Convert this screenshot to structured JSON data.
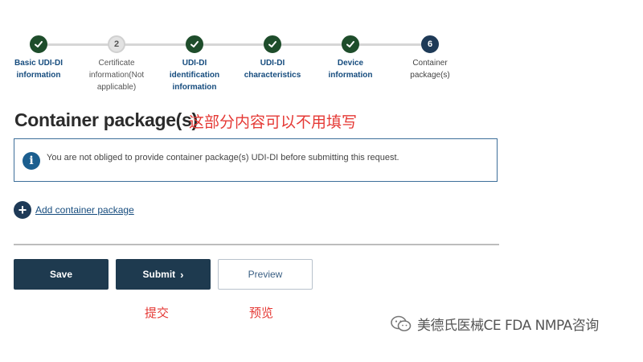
{
  "stepper": {
    "steps": [
      {
        "label": "Basic UDI-DI\ninformation",
        "status": "done",
        "number": ""
      },
      {
        "label": "Certificate\ninformation(Not\napplicable)",
        "status": "pending",
        "number": "2"
      },
      {
        "label": "UDI-DI\nidentification\ninformation",
        "status": "done",
        "number": ""
      },
      {
        "label": "UDI-DI\ncharacteristics",
        "status": "done",
        "number": ""
      },
      {
        "label": "Device\ninformation",
        "status": "done",
        "number": ""
      },
      {
        "label": "Container\npackage(s)",
        "status": "current",
        "number": "6"
      }
    ]
  },
  "page": {
    "title": "Container package(s)",
    "note": "这部分内容可以不用填写"
  },
  "info": {
    "text": "You are not obliged to provide container package(s) UDI-DI before submitting this request.",
    "icon": "i"
  },
  "add": {
    "icon": "+",
    "label": "Add container package"
  },
  "buttons": {
    "save": "Save",
    "submit": "Submit",
    "submit_chevron": "›",
    "preview": "Preview"
  },
  "annotations": {
    "submit": "提交",
    "preview": "预览"
  },
  "watermark": {
    "text": "美德氏医械CE FDA NMPA咨询"
  },
  "colors": {
    "done": "#1e4d2b",
    "current": "#1e3a57",
    "primary_button": "#1e3a4f",
    "link": "#164c7e",
    "annotation": "#e53935"
  }
}
